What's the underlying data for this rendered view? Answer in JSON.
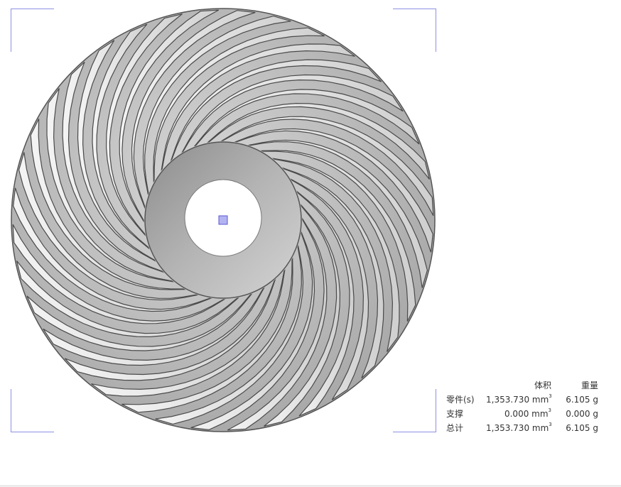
{
  "stats_table": {
    "headers": [
      "",
      "体积",
      "重量"
    ],
    "rows": [
      {
        "label": "零件(s)",
        "volume": "1,353.730 mm",
        "weight": "6.105 g"
      },
      {
        "label": "支撑",
        "volume": "0.000 mm",
        "weight": "0.000 g"
      },
      {
        "label": "总计",
        "volume": "1,353.730 mm",
        "weight": "6.105 g"
      }
    ],
    "volume_superscript": "3"
  },
  "model": {
    "blade_count": 36,
    "colors": {
      "disc": "#bdbdbd",
      "blade": "#e8e8e8",
      "blade_edge": "#4a4a4a",
      "hub": "#9a9a9a",
      "bore": "#ffffff",
      "center_marker": "#b3b3f2",
      "corner_brackets": "#8f8fe6"
    }
  }
}
